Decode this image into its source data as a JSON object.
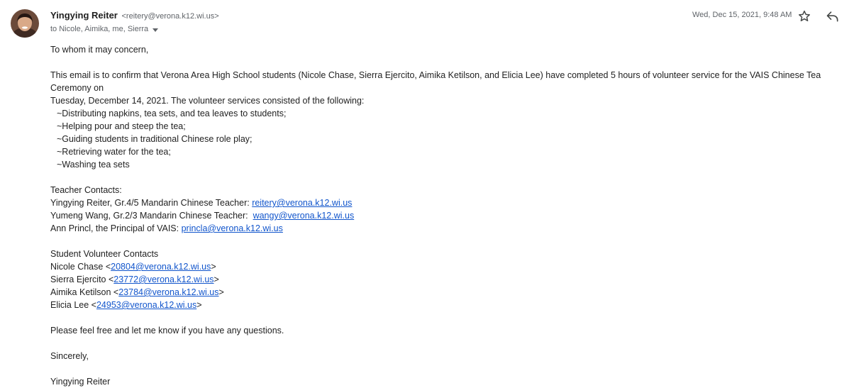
{
  "header": {
    "sender_name": "Yingying Reiter",
    "sender_email": "<reitery@verona.k12.wi.us>",
    "recipients": "to Nicole, Aimika, me, Sierra",
    "date": "Wed, Dec 15, 2021, 9:48 AM"
  },
  "body": {
    "greeting": "To whom it may concern,",
    "intro_line1": "This email is to confirm that Verona Area High School students (Nicole Chase, Sierra Ejercito, Aimika Ketilson, and Elicia Lee) have completed 5 hours of volunteer service for the VAIS Chinese Tea Ceremony on",
    "intro_line2": "Tuesday, December 14, 2021. The volunteer services consisted of the following:",
    "services": [
      "~Distributing napkins, tea sets, and tea leaves to students;",
      "~Helping pour and steep the tea;",
      "~Guiding students in traditional Chinese role play;",
      "~Retrieving water for the tea;",
      "~Washing tea sets"
    ],
    "teacher_heading": "Teacher Contacts:",
    "teachers": [
      {
        "label": "Yingying Reiter, Gr.4/5 Mandarin Chinese Teacher: ",
        "email": "reitery@verona.k12.wi.us"
      },
      {
        "label": "Yumeng Wang, Gr.2/3 Mandarin Chinese Teacher:  ",
        "email": "wangy@verona.k12.wi.us"
      },
      {
        "label": "Ann Princl, the Principal of VAIS: ",
        "email": "princla@verona.k12.wi.us"
      }
    ],
    "student_heading": "Student Volunteer Contacts",
    "students": [
      {
        "name": "Nicole Chase <",
        "email": "20804@verona.k12.wi.us",
        "close": ">"
      },
      {
        "name": "Sierra Ejercito <",
        "email": "23772@verona.k12.wi.us",
        "close": ">"
      },
      {
        "name": "Aimika Ketilson <",
        "email": "23784@verona.k12.wi.us",
        "close": ">"
      },
      {
        "name": "Elicia Lee <",
        "email": "24953@verona.k12.wi.us",
        "close": ">"
      }
    ],
    "closing_line": "Please feel free and let me know if you have any questions.",
    "signoff": "Sincerely,",
    "signature": "Yingying Reiter"
  },
  "icons": {
    "avatar": "avatar-photo",
    "star": "star-outline-icon",
    "reply": "reply-arrow-icon",
    "expand": "caret-down-icon"
  }
}
